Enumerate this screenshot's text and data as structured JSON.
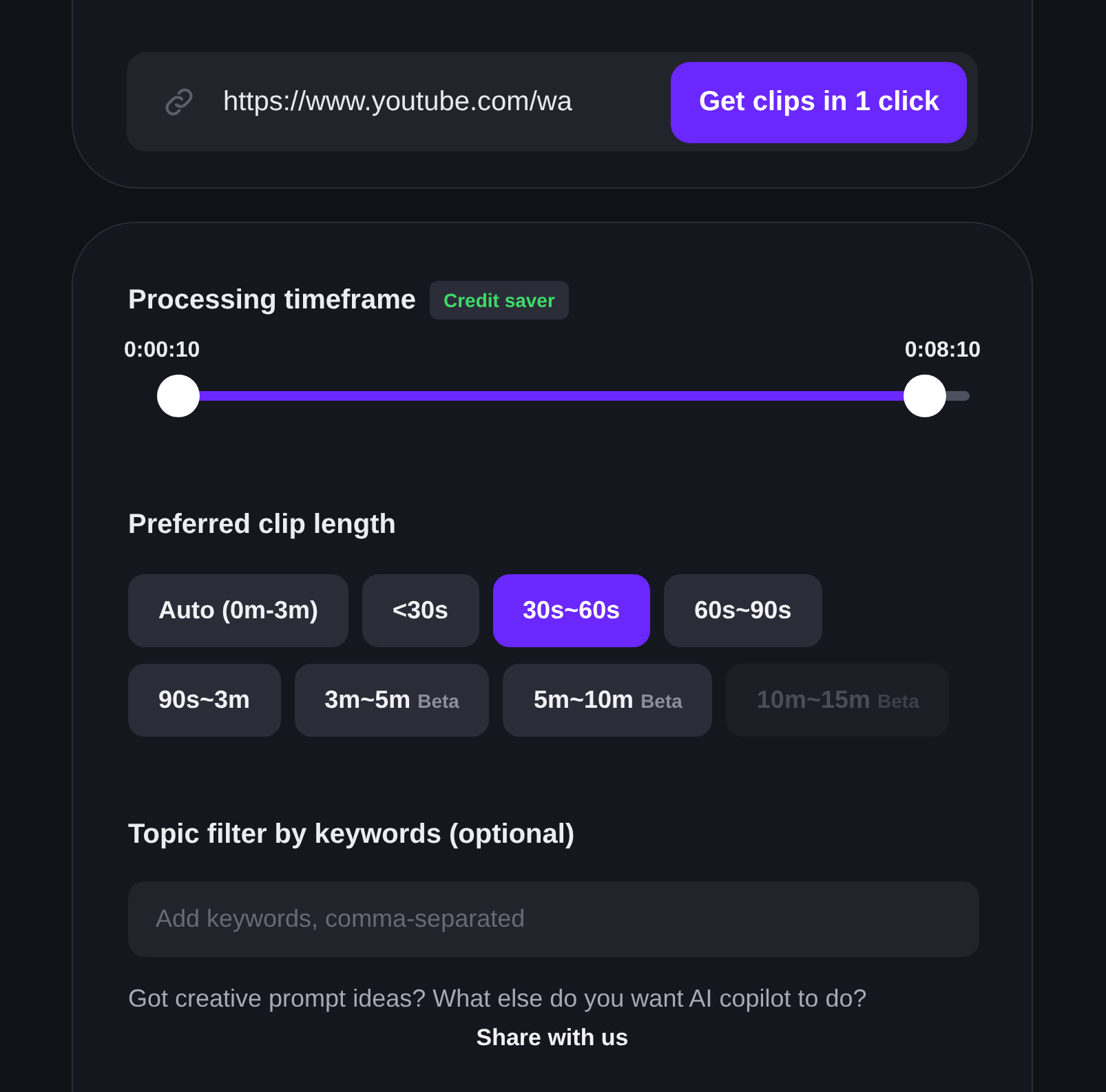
{
  "url_bar": {
    "value": "https://www.youtube.com/wa",
    "button": "Get clips in 1 click"
  },
  "timeframe": {
    "title": "Processing timeframe",
    "badge": "Credit saver",
    "thumbs": [
      {
        "label": "0:00:10",
        "level": 0
      },
      {
        "label": "0:08:10",
        "level": 0.943
      }
    ]
  },
  "clip_length": {
    "title": "Preferred clip length",
    "options": [
      {
        "label": "Auto (0m-3m)",
        "selected": false,
        "disabled": false
      },
      {
        "label": "<30s",
        "selected": false,
        "disabled": false
      },
      {
        "label": "30s~60s",
        "selected": true,
        "disabled": false
      },
      {
        "label": "60s~90s",
        "selected": false,
        "disabled": false
      },
      {
        "label": "90s~3m",
        "selected": false,
        "disabled": false
      },
      {
        "label": "3m~5m",
        "tag": "Beta",
        "selected": false,
        "disabled": false
      },
      {
        "label": "5m~10m",
        "tag": "Beta",
        "selected": false,
        "disabled": false
      },
      {
        "label": "10m~15m",
        "tag": "Beta",
        "selected": false,
        "disabled": true
      }
    ]
  },
  "topic_filter": {
    "title": "Topic filter by keywords (optional)",
    "placeholder": "Add keywords, comma-separated"
  },
  "feedback": {
    "text": "Got creative prompt ideas? What else do you want AI copilot to do?",
    "link": "Share with us"
  }
}
